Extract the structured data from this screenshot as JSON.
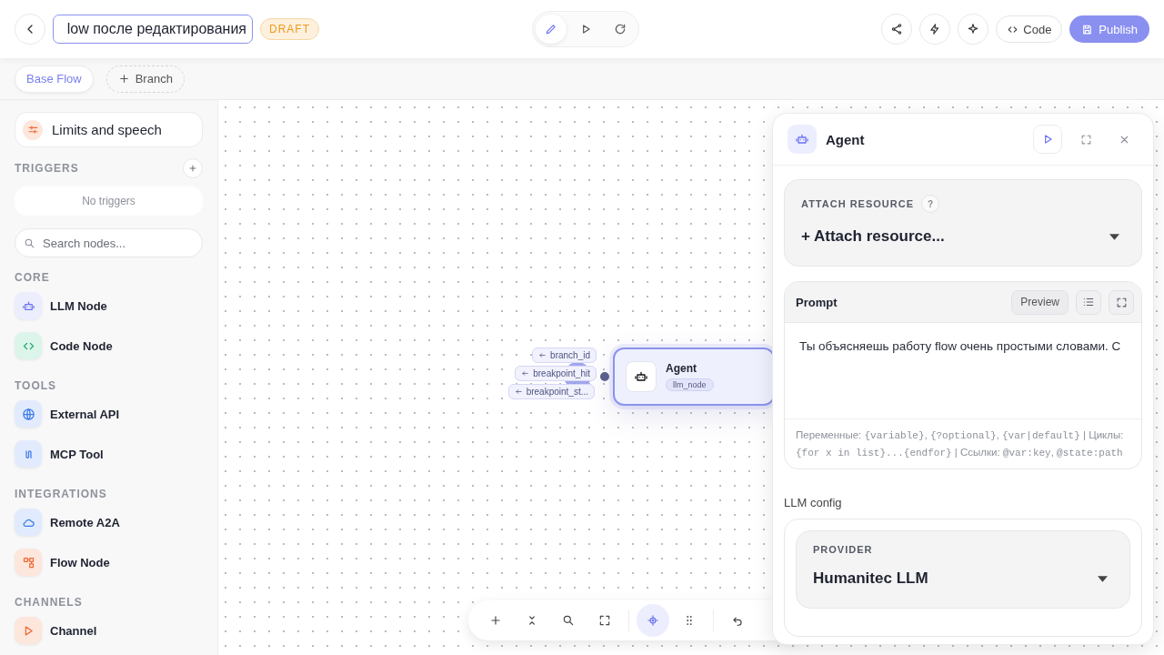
{
  "header": {
    "title_value": "low после редактирования",
    "status": "DRAFT",
    "modes": [
      {
        "kind": "edit",
        "selected": true
      },
      {
        "kind": "play",
        "selected": false
      },
      {
        "kind": "refresh",
        "selected": false
      }
    ],
    "actions": [
      {
        "kind": "share"
      },
      {
        "kind": "bolt"
      },
      {
        "kind": "sparkle"
      }
    ],
    "code_button": "Code",
    "publish_button": "Publish"
  },
  "branches": [
    {
      "label": "Base Flow",
      "kind": "branch",
      "selected": true
    },
    {
      "label": "Branch",
      "kind": "add",
      "selected": false
    }
  ],
  "sidebar": {
    "settings_item": "Limits and speech",
    "triggers_heading": "TRIGGERS",
    "triggers_empty": "No triggers",
    "search": {
      "placeholder": "Search nodes..."
    },
    "sections": [
      {
        "heading": "CORE",
        "items": [
          {
            "label": "LLM Node",
            "kind": "llm"
          },
          {
            "label": "Code Node",
            "kind": "code"
          }
        ]
      },
      {
        "heading": "TOOLS",
        "items": [
          {
            "label": "External API",
            "kind": "api"
          },
          {
            "label": "MCP Tool",
            "kind": "mcp"
          }
        ]
      },
      {
        "heading": "INTEGRATIONS",
        "items": [
          {
            "label": "Remote A2A",
            "kind": "remote"
          },
          {
            "label": "Flow Node",
            "kind": "flow"
          }
        ]
      },
      {
        "heading": "CHANNELS",
        "items": [
          {
            "label": "Channel",
            "kind": "channel"
          }
        ]
      }
    ]
  },
  "node": {
    "title": "Agent",
    "type": "llm_node",
    "inputs": [
      "branch_id",
      "breakpoint_hit",
      "breakpoint_st..."
    ]
  },
  "toolbar": [
    {
      "kind": "plus",
      "selected": false
    },
    {
      "kind": "collapse",
      "selected": false
    },
    {
      "kind": "search",
      "selected": false
    },
    {
      "kind": "fullscreen",
      "selected": false
    },
    {
      "kind": "target",
      "selected": true
    },
    {
      "kind": "grid",
      "selected": false
    },
    {
      "kind": "undo",
      "selected": false
    }
  ],
  "panel": {
    "title": "Agent",
    "attach": {
      "label": "ATTACH RESOURCE",
      "help": "?",
      "value": "+ Attach resource..."
    },
    "prompt": {
      "title": "Prompt",
      "preview": "Preview",
      "text": "Ты объясняешь работу flow очень простыми словами. С",
      "hint": [
        {
          "kind": "plain",
          "text": "Переменные: "
        },
        {
          "kind": "code",
          "text": "{variable}"
        },
        {
          "kind": "plain",
          "text": ", "
        },
        {
          "kind": "code",
          "text": "{?optional}"
        },
        {
          "kind": "plain",
          "text": ", "
        },
        {
          "kind": "code",
          "text": "{var|default}"
        },
        {
          "kind": "plain",
          "text": " | Циклы: "
        },
        {
          "kind": "code",
          "text": "{for x in list}...{endfor}"
        },
        {
          "kind": "plain",
          "text": " | Ссылки: "
        },
        {
          "kind": "code",
          "text": "@var:key"
        },
        {
          "kind": "plain",
          "text": ", "
        },
        {
          "kind": "code",
          "text": "@state:path"
        }
      ]
    },
    "llm_config": {
      "label": "LLM config",
      "provider_label": "PROVIDER",
      "provider": "Humanitec LLM"
    }
  }
}
